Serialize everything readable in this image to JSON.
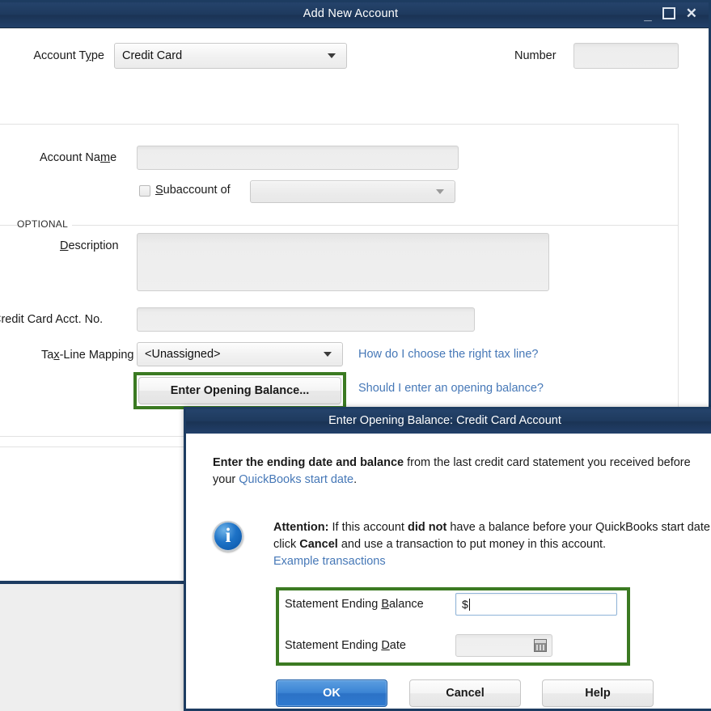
{
  "main_window": {
    "title": "Add New Account",
    "window_controls": {
      "minimize": "minimize-icon",
      "maximize": "maximize-icon",
      "close": "close-icon"
    },
    "account_type": {
      "label": "Account Type",
      "value": "Credit Card"
    },
    "number": {
      "label": "Number",
      "value": "",
      "placeholder": ""
    },
    "account_name": {
      "label": "Account Name",
      "value": "",
      "placeholder": ""
    },
    "subaccount": {
      "label": "Subaccount of",
      "checked": false,
      "value": "",
      "placeholder": ""
    },
    "optional_group_label": "OPTIONAL",
    "description": {
      "label": "Description",
      "value": "",
      "placeholder": ""
    },
    "credit_card_acct_no": {
      "label": "Credit Card Acct. No.",
      "value": "",
      "placeholder": ""
    },
    "tax_line_mapping": {
      "label": "Tax-Line Mapping",
      "value": "<Unassigned>"
    },
    "links": {
      "tax_line_help": "How do I choose the right tax line?",
      "opening_balance_help": "Should I enter an opening balance?"
    },
    "opening_balance_button": "Enter Opening Balance..."
  },
  "modal": {
    "title": "Enter Opening Balance: Credit Card Account",
    "intro": {
      "bold_lead": "Enter the ending date and balance",
      "rest_before_link": " from the last credit card statement you received before your ",
      "link": "QuickBooks start date",
      "rest_after_link": "."
    },
    "attention": {
      "bold_lead": "Attention:",
      "part1": " If this account ",
      "bold_did_not": "did not",
      "part2": " have a balance before your QuickBooks start date, click ",
      "bold_cancel": "Cancel",
      "part3": " and use a transaction to put money in this account."
    },
    "example_link": "Example transactions",
    "statement_ending_balance": {
      "label": "Statement Ending Balance",
      "value": "$",
      "focused": true
    },
    "statement_ending_date": {
      "label": "Statement Ending Date",
      "value": "",
      "calendar_icon": "calendar-icon"
    },
    "buttons": {
      "ok": "OK",
      "cancel": "Cancel",
      "help": "Help"
    },
    "info_icon": "info-icon"
  },
  "colors": {
    "titlebar_navy": "#1e3a5e",
    "window_border_navy": "#1d3c61",
    "highlight_green": "#3b7a22",
    "link_blue": "#4678b7",
    "primary_button_blue": "#3b84d4",
    "focus_border_blue": "#8fb4d9"
  }
}
